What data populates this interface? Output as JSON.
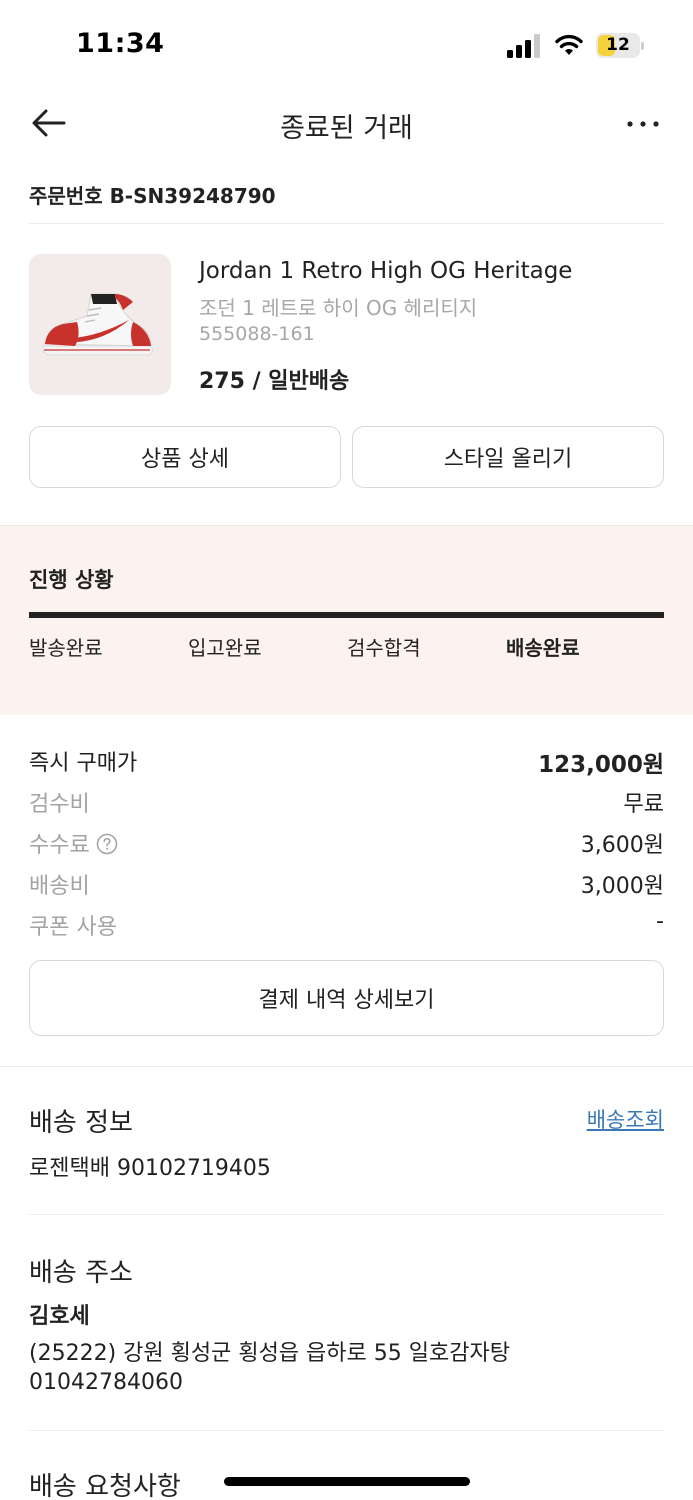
{
  "status_bar": {
    "time": "11:34",
    "battery": "12"
  },
  "header": {
    "title": "종료된 거래"
  },
  "order": {
    "number": "주문번호 B-SN39248790"
  },
  "product": {
    "name": "Jordan 1 Retro High OG Heritage",
    "name_kor": "조던 1 레트로 하이 OG 헤리티지",
    "code": "555088-161",
    "option": "275 / 일반배송"
  },
  "buttons": {
    "detail": "상품 상세",
    "style": "스타일 올리기",
    "payment_detail": "결제 내역 상세보기"
  },
  "progress": {
    "title": "진행 상황",
    "steps": [
      "발송완료",
      "입고완료",
      "검수합격",
      "배송완료"
    ],
    "current_step": 4
  },
  "price": {
    "rows": [
      {
        "label": "즉시 구매가",
        "value": "123,000원"
      },
      {
        "label": "검수비",
        "value": "무료"
      },
      {
        "label": "수수료",
        "value": "3,600원"
      },
      {
        "label": "배송비",
        "value": "3,000원"
      },
      {
        "label": "쿠폰 사용",
        "value": "-"
      }
    ]
  },
  "shipping_info": {
    "title": "배송 정보",
    "link": "배송조회",
    "carrier": "로젠택배 90102719405"
  },
  "shipping_address": {
    "title": "배송 주소",
    "name": "김호세",
    "address": "(25222) 강원 횡성군 횡성읍 읍하로 55 일호감자탕",
    "phone": "01042784060"
  },
  "shipping_request": {
    "title": "배송 요청사항"
  },
  "colors": {
    "accent_link": "#3b78b8",
    "progress_bg": "#fcf2f0",
    "battery": "#f5d13b"
  }
}
